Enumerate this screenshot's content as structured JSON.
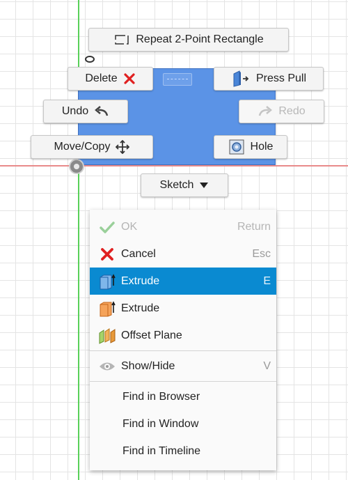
{
  "marking_menu": {
    "repeat_label": "Repeat 2-Point Rectangle",
    "delete_label": "Delete",
    "press_pull_label": "Press Pull",
    "undo_label": "Undo",
    "redo_label": "Redo",
    "move_copy_label": "Move/Copy",
    "hole_label": "Hole",
    "sketch_label": "Sketch"
  },
  "context_menu": {
    "items": [
      {
        "label": "OK",
        "shortcut": "Return",
        "icon": "checkmark-icon",
        "disabled": true
      },
      {
        "label": "Cancel",
        "shortcut": "Esc",
        "icon": "cancel-x-icon"
      },
      {
        "label": "Extrude",
        "shortcut": "E",
        "icon": "extrude-icon",
        "selected": true
      },
      {
        "label": "Extrude",
        "shortcut": "",
        "icon": "extrude-orange-icon"
      },
      {
        "label": "Offset Plane",
        "shortcut": "",
        "icon": "offset-plane-icon"
      },
      {
        "label": "Show/Hide",
        "shortcut": "V",
        "icon": "eye-icon"
      },
      {
        "label": "Find in Browser",
        "shortcut": ""
      },
      {
        "label": "Find in Window",
        "shortcut": ""
      },
      {
        "label": "Find in Timeline",
        "shortcut": ""
      }
    ]
  },
  "colors": {
    "selection_blue": "#0a8ad1",
    "sketch_fill": "#5b93e6",
    "x_axis": "#e88a8a",
    "y_axis": "#58d058",
    "cancel_red": "#e02020"
  }
}
